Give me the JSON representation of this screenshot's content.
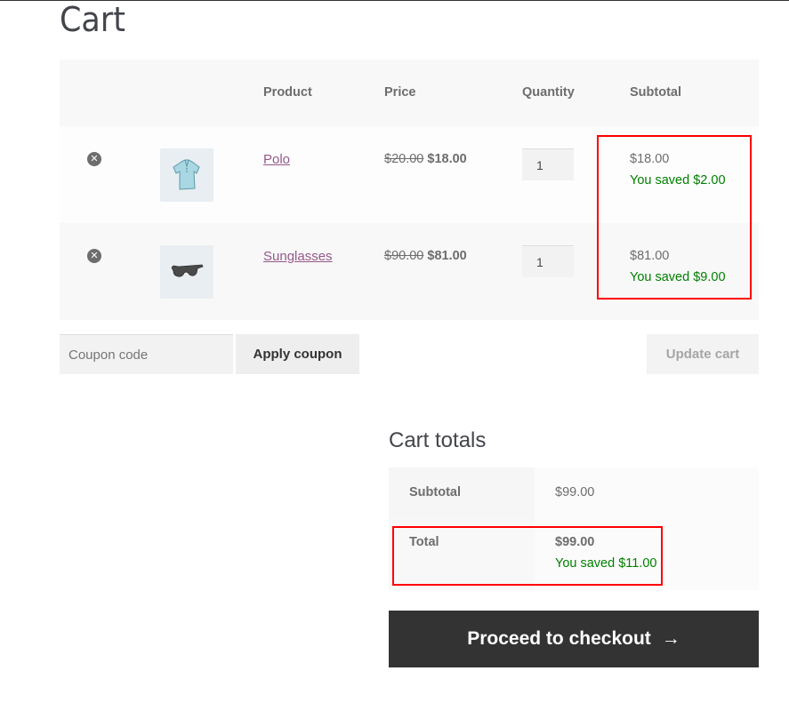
{
  "page": {
    "title": "Cart"
  },
  "table": {
    "headers": [
      "",
      "",
      "Product",
      "Price",
      "Quantity",
      "Subtotal"
    ],
    "rows": [
      {
        "product": "Polo",
        "thumb_icon": "polo-shirt-image",
        "regular_price": "$20.00",
        "sale_price": "$18.00",
        "quantity": "1",
        "subtotal": "$18.00",
        "saved": "You saved $2.00"
      },
      {
        "product": "Sunglasses",
        "thumb_icon": "sunglasses-image",
        "regular_price": "$90.00",
        "sale_price": "$81.00",
        "quantity": "1",
        "subtotal": "$81.00",
        "saved": "You saved $9.00"
      }
    ]
  },
  "actions": {
    "coupon_placeholder": "Coupon code",
    "apply_coupon": "Apply coupon",
    "update_cart": "Update cart"
  },
  "totals": {
    "title": "Cart totals",
    "subtotal_label": "Subtotal",
    "subtotal_value": "$99.00",
    "total_label": "Total",
    "total_value": "$99.00",
    "total_saved": "You saved $11.00"
  },
  "checkout": {
    "label": "Proceed to checkout",
    "icon": "→"
  },
  "colors": {
    "link": "#96588a",
    "saved": "#008000",
    "highlight": "#ff0000",
    "checkout_bg": "#333333"
  }
}
